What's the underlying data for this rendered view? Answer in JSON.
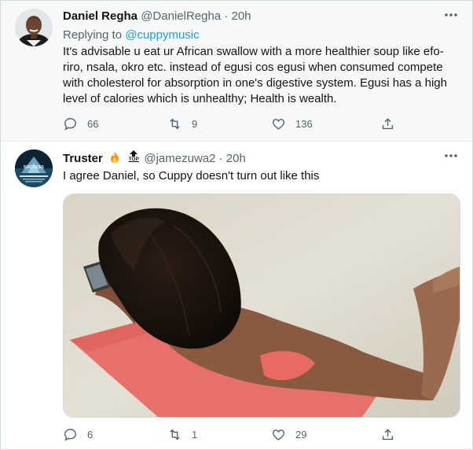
{
  "tweet1": {
    "display_name": "Daniel Regha",
    "handle_time": "@DanielRegha · 20h",
    "replying_prefix": "Replying to",
    "replying_to": "@cuppymusic",
    "text": "It's advisable u eat ur African swallow with a more healthier soup like efo-riro, nsala, okro etc. instead of egusi cos egusi when consumed compete with cholesterol for absorption in one's digestive system. Egusi has a high level of calories which is unhealthy; Health is wealth.",
    "replies": "66",
    "retweets": "9",
    "likes": "136"
  },
  "tweet2": {
    "display_name": "Truster",
    "handle_time": "@jamezuwa2 · 20h",
    "avatar_text": "SUCCESS",
    "top_badge": "TOP",
    "text": "I agree Daniel, so Cuppy doesn't turn out like this",
    "replies": "6",
    "retweets": "1",
    "likes": "29"
  },
  "icons": [
    "more-icon",
    "reply-icon",
    "retweet-icon",
    "like-icon",
    "share-icon",
    "fire-emoji-icon",
    "top-arrow-icon"
  ],
  "colors": {
    "accent": "#1d9bf0",
    "secondary_text": "#536471",
    "hover_bg": "#f7f9f9"
  }
}
